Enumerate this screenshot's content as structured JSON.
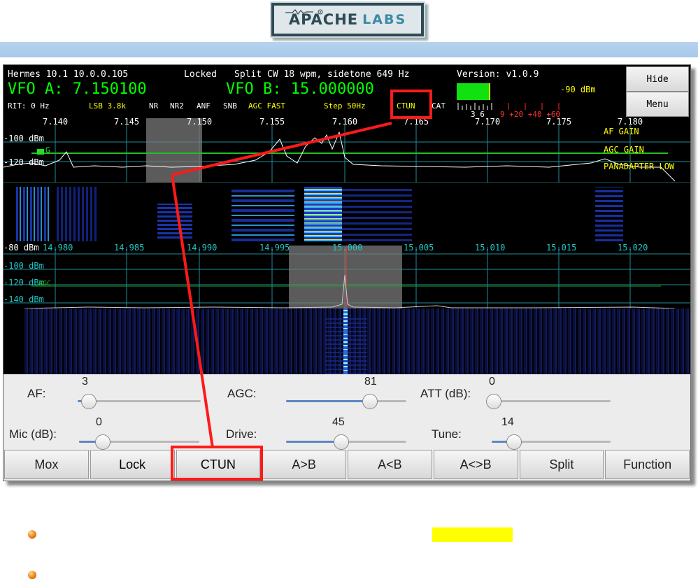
{
  "logo": {
    "part1": "APACHE",
    "part2": "LABS"
  },
  "status": {
    "device": "Hermes 10.1 10.0.0.105",
    "locked": "Locked",
    "split": "Split CW 18 wpm, sidetone 649 Hz",
    "version": "Version: v1.0.9",
    "vfo_a": "VFO A: 7.150100",
    "vfo_b": "VFO B: 15.000000",
    "meter_dbm": "-90 dBm",
    "rit": "RIT: 0 Hz",
    "mode": "LSB 3.8k",
    "nr": "NR",
    "nr2": "NR2",
    "anf": "ANF",
    "snb": "SNB",
    "agc": "AGC FAST",
    "step": "Step 50Hz",
    "ctun": "CTUN",
    "cat": "CAT",
    "meter_scale_white": "3  6",
    "meter_scale_red": "9 +20 +40 +60"
  },
  "side_buttons": {
    "hide": "Hide",
    "menu": "Menu"
  },
  "panadapter_a": {
    "freqs": [
      "7.140",
      "7.145",
      "7.150",
      "7.155",
      "7.160",
      "7.165",
      "7.170",
      "7.175",
      "7.180"
    ],
    "levels": [
      "-100 dBm",
      "-120 dBm"
    ],
    "af_gain": "AF GAIN",
    "agc_gain": "AGC GAIN",
    "panadapter_low": "PANADAPTER LOW",
    "agc_marker": "G"
  },
  "panadapter_b": {
    "freqs": [
      "14.980",
      "14.985",
      "14.990",
      "14.995",
      "15.000",
      "15.005",
      "15.010",
      "15.015",
      "15.020"
    ],
    "levels": [
      "-80 dBm",
      "-100 dBm",
      "-120 dBm",
      "-140 dBm"
    ],
    "agc_marker": "AGC"
  },
  "controls": {
    "af": {
      "label": "AF:",
      "value": "3",
      "level": 0.03
    },
    "agc": {
      "label": "AGC:",
      "value": "81",
      "level": 0.72
    },
    "att": {
      "label": "ATT (dB):",
      "value": "0",
      "level": 0.0
    },
    "mic": {
      "label": "Mic (dB):",
      "value": "0",
      "level": 0.15
    },
    "drive": {
      "label": "Drive:",
      "value": "45",
      "level": 0.45
    },
    "tune": {
      "label": "Tune:",
      "value": "14",
      "level": 0.14
    }
  },
  "buttons": [
    "Mox",
    "Lock",
    "CTUN",
    "A>B",
    "A<B",
    "A<>B",
    "Split",
    "Function"
  ],
  "colors": {
    "vfo": "#00ff00",
    "yellow": "#ffff00",
    "cyan": "#22c6c6",
    "highlight": "#ff1a1a",
    "band": "#a8cbea"
  }
}
